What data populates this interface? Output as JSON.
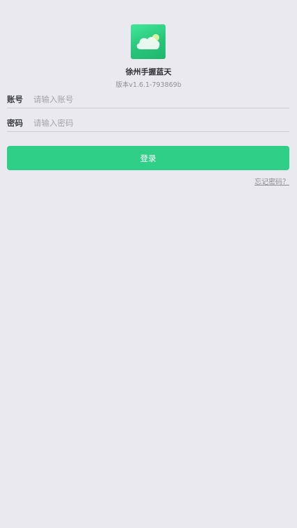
{
  "app": {
    "title": "徐州手握蓝天",
    "version": "版本v1.6.1-793869b",
    "logo_icon": "cloud-sun-icon",
    "accent_color": "#2fcf87"
  },
  "form": {
    "account_label": "账号",
    "account_placeholder": "请输入账号",
    "account_value": "",
    "password_label": "密码",
    "password_placeholder": "请输入密码",
    "password_value": "",
    "login_label": "登录",
    "forgot_label": "忘记密码？"
  }
}
